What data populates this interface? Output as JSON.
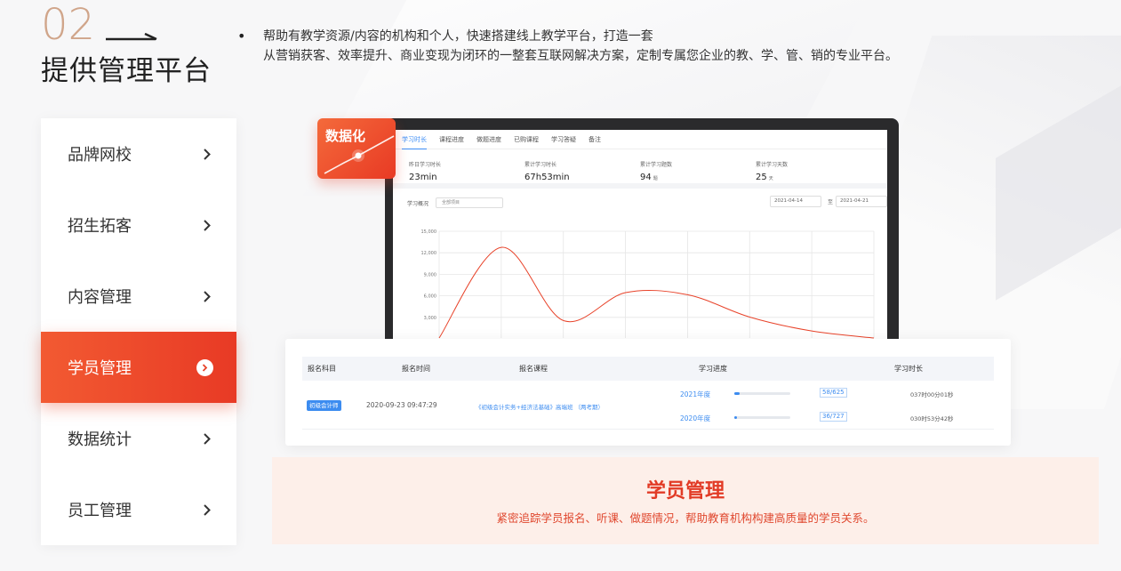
{
  "section": {
    "number": "02",
    "title": "提供管理平台",
    "description_line1": "帮助有教学资源/内容的机构和个人，快速搭建线上教学平台，打造一套",
    "description_line2": "从营销获客、效率提升、商业变现为闭环的一整套互联网解决方案，定制专属您企业的教、学、管、销的专业平台。"
  },
  "menu": {
    "items": [
      {
        "label": "品牌网校",
        "icon": "chevron-right-icon"
      },
      {
        "label": "招生拓客",
        "icon": "chevron-right-icon"
      },
      {
        "label": "内容管理",
        "icon": "chevron-right-icon"
      },
      {
        "label": "学员管理",
        "icon": "chevron-right-circle-icon",
        "active": true
      },
      {
        "label": "数据统计",
        "icon": "chevron-right-icon"
      },
      {
        "label": "员工管理",
        "icon": "chevron-right-icon"
      }
    ]
  },
  "badge": {
    "label": "数据化"
  },
  "dashboard": {
    "tabs": [
      "学习时长",
      "课程进度",
      "做题进度",
      "已购课程",
      "学习答疑",
      "备注"
    ],
    "active_tab": 0,
    "stats": [
      {
        "label": "昨日学习时长",
        "value": "23min",
        "unit": ""
      },
      {
        "label": "累计学习时长",
        "value": "67h53min",
        "unit": ""
      },
      {
        "label": "累计学习题数",
        "value": "94",
        "unit": "题"
      },
      {
        "label": "累计学习天数",
        "value": "25",
        "unit": "天"
      }
    ],
    "filter_label": "学习概况",
    "filter_select": "全部项目",
    "date_from": "2021-04-14",
    "date_sep": "至",
    "date_to": "2021-04-21"
  },
  "chart_data": {
    "type": "line",
    "y_ticks": [
      "15,000",
      "12,000",
      "9,000",
      "6,000",
      "3,000"
    ],
    "ylim": [
      0,
      15000
    ],
    "x": [
      0,
      1,
      2,
      3,
      4,
      5,
      6,
      7
    ],
    "values": [
      0,
      13000,
      2500,
      6500,
      6200,
      3000,
      1000,
      0
    ],
    "color": "#e8432a"
  },
  "table": {
    "headers": [
      "报名科目",
      "报名时间",
      "报名课程",
      "学习进度",
      "学习时长"
    ],
    "row": {
      "subject_tag": "初级会计师",
      "time": "2020-09-23 09:47:29",
      "course": "《初级会计实务+经济法基础》高端班 （两考期）",
      "progress": [
        {
          "year": "2021年度",
          "fraction": 0.093,
          "count": "58/625",
          "duration": "037时00分01秒"
        },
        {
          "year": "2020年度",
          "fraction": 0.05,
          "count": "36/727",
          "duration": "030时53分42秒"
        }
      ]
    }
  },
  "feature": {
    "title": "学员管理",
    "subtitle": "紧密追踪学员报名、听课、做题情况，帮助教育机构构建高质量的学员关系。"
  },
  "colors": {
    "accent": "#e8432a",
    "number_gold": "#d0a58a",
    "link_blue": "#3c8cf0",
    "strip_bg": "#fdefe9"
  }
}
